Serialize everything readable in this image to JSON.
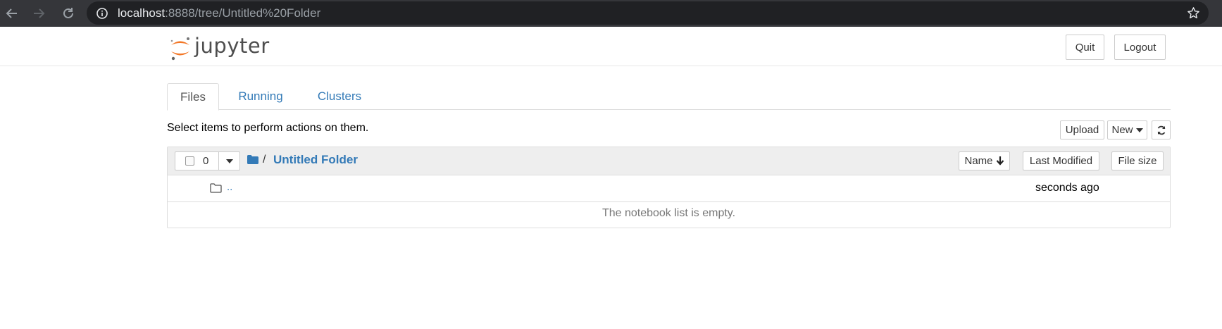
{
  "browser": {
    "url_host": "localhost",
    "url_rest": ":8888/tree/Untitled%20Folder"
  },
  "header": {
    "logo_text": "jupyter",
    "quit_label": "Quit",
    "logout_label": "Logout"
  },
  "tabs": [
    {
      "label": "Files",
      "active": true
    },
    {
      "label": "Running",
      "active": false
    },
    {
      "label": "Clusters",
      "active": false
    }
  ],
  "toolbar": {
    "hint": "Select items to perform actions on them.",
    "upload_label": "Upload",
    "new_label": "New"
  },
  "list": {
    "selected_count": "0",
    "breadcrumb_slash": "/",
    "folder_name": "Untitled Folder",
    "sort_name_label": "Name",
    "sort_modified_label": "Last Modified",
    "sort_size_label": "File size",
    "parent_label": "..",
    "parent_modified": "seconds ago",
    "empty_message": "The notebook list is empty."
  },
  "colors": {
    "link": "#337ab7",
    "logo_orange": "#f37726",
    "chrome_bg": "#35363a"
  }
}
